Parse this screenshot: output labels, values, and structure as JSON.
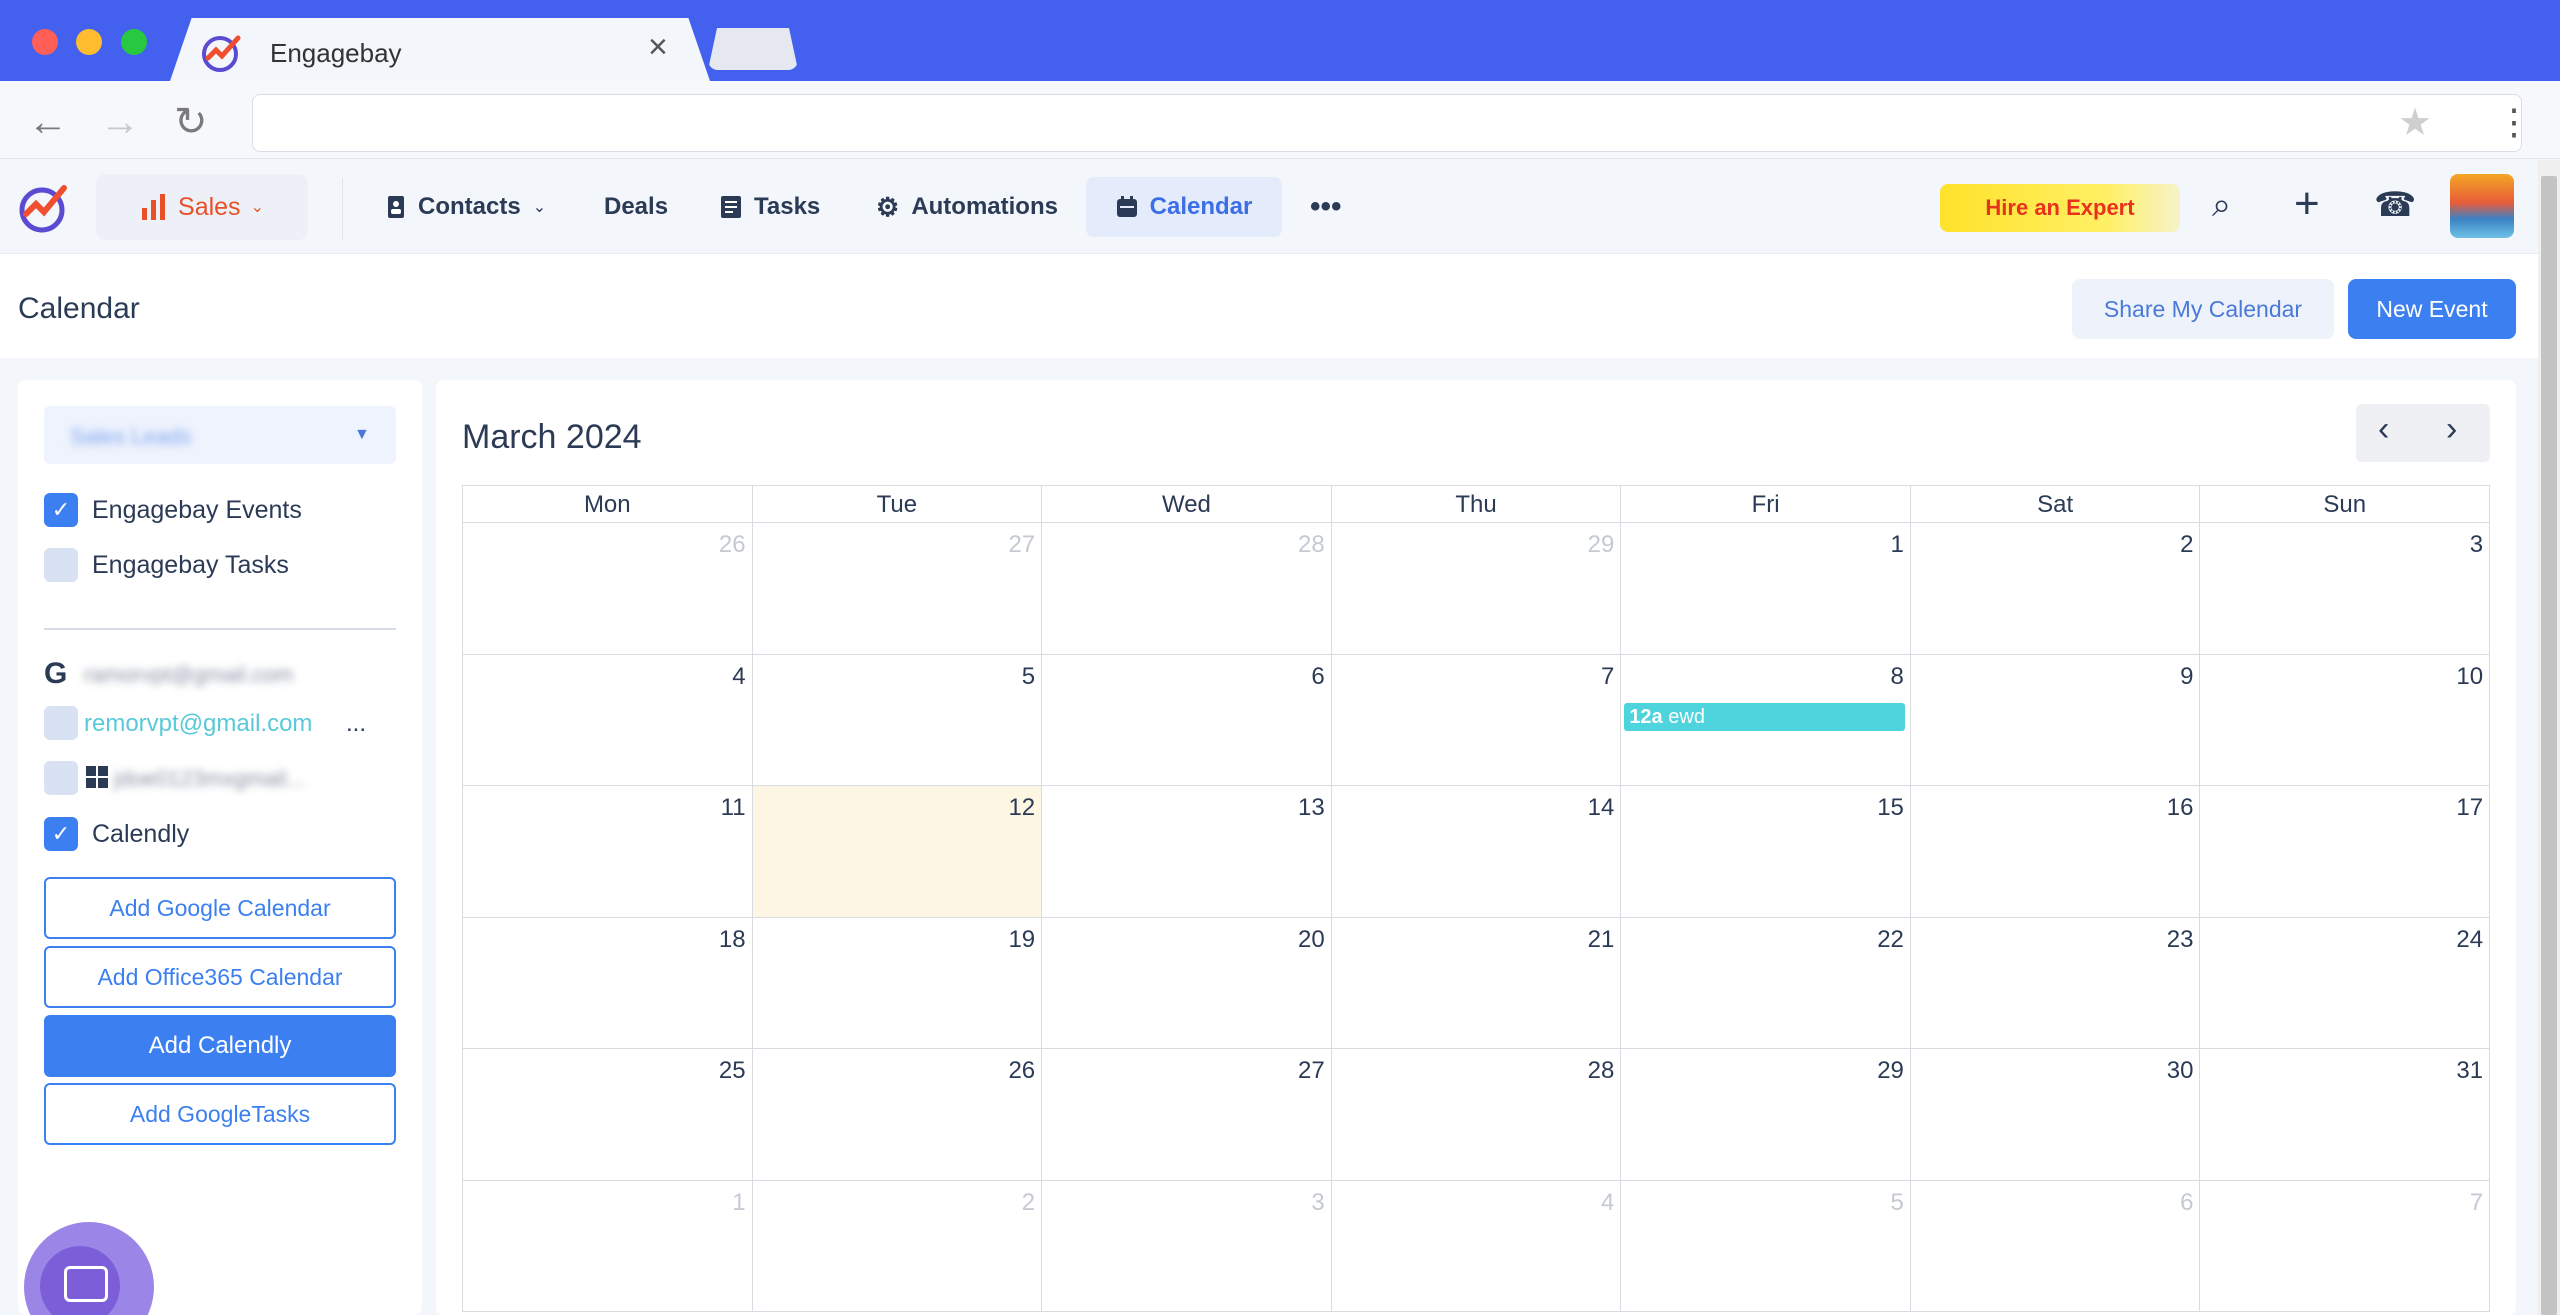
{
  "browser": {
    "tab_title": "Engagebay",
    "url": ""
  },
  "nav": {
    "sales_label": "Sales",
    "contacts_label": "Contacts",
    "deals_label": "Deals",
    "tasks_label": "Tasks",
    "automations_label": "Automations",
    "calendar_label": "Calendar",
    "more_label": "•••",
    "hire_label": "Hire an Expert"
  },
  "header": {
    "title": "Calendar",
    "share_label": "Share My Calendar",
    "new_event_label": "New Event"
  },
  "sidebar": {
    "select_value": "Sales Leads",
    "engagebay_events": "Engagebay Events",
    "engagebay_tasks": "Engagebay Tasks",
    "google_account": "ramorvpt@gmail.com",
    "linked_account": "remorvpt@gmail.com",
    "linked_ellipsis": "...",
    "office_account": "jdoe0123mxgmail...",
    "calendly_label": "Calendly",
    "add_google": "Add Google Calendar",
    "add_office": "Add Office365 Calendar",
    "add_calendly": "Add Calendly",
    "add_googletasks": "Add GoogleTasks"
  },
  "calendar": {
    "month_label": "March 2024",
    "weekdays": [
      "Mon",
      "Tue",
      "Wed",
      "Thu",
      "Fri",
      "Sat",
      "Sun"
    ],
    "weeks": [
      [
        {
          "d": "26",
          "muted": true
        },
        {
          "d": "27",
          "muted": true
        },
        {
          "d": "28",
          "muted": true
        },
        {
          "d": "29",
          "muted": true
        },
        {
          "d": "1"
        },
        {
          "d": "2"
        },
        {
          "d": "3"
        }
      ],
      [
        {
          "d": "4"
        },
        {
          "d": "5"
        },
        {
          "d": "6"
        },
        {
          "d": "7"
        },
        {
          "d": "8",
          "event": {
            "time": "12a",
            "title": "ewd"
          }
        },
        {
          "d": "9"
        },
        {
          "d": "10"
        }
      ],
      [
        {
          "d": "11"
        },
        {
          "d": "12",
          "today": true
        },
        {
          "d": "13"
        },
        {
          "d": "14"
        },
        {
          "d": "15"
        },
        {
          "d": "16"
        },
        {
          "d": "17"
        }
      ],
      [
        {
          "d": "18"
        },
        {
          "d": "19"
        },
        {
          "d": "20"
        },
        {
          "d": "21"
        },
        {
          "d": "22"
        },
        {
          "d": "23"
        },
        {
          "d": "24"
        }
      ],
      [
        {
          "d": "25"
        },
        {
          "d": "26"
        },
        {
          "d": "27"
        },
        {
          "d": "28"
        },
        {
          "d": "29"
        },
        {
          "d": "30"
        },
        {
          "d": "31"
        }
      ],
      [
        {
          "d": "1",
          "muted": true
        },
        {
          "d": "2",
          "muted": true
        },
        {
          "d": "3",
          "muted": true
        },
        {
          "d": "4",
          "muted": true
        },
        {
          "d": "5",
          "muted": true
        },
        {
          "d": "6",
          "muted": true
        },
        {
          "d": "7",
          "muted": true
        }
      ]
    ]
  },
  "colors": {
    "brand": "#4361ee",
    "accent": "#3c7ff0",
    "event": "#4dd4dc",
    "today": "#fdf6e3"
  }
}
